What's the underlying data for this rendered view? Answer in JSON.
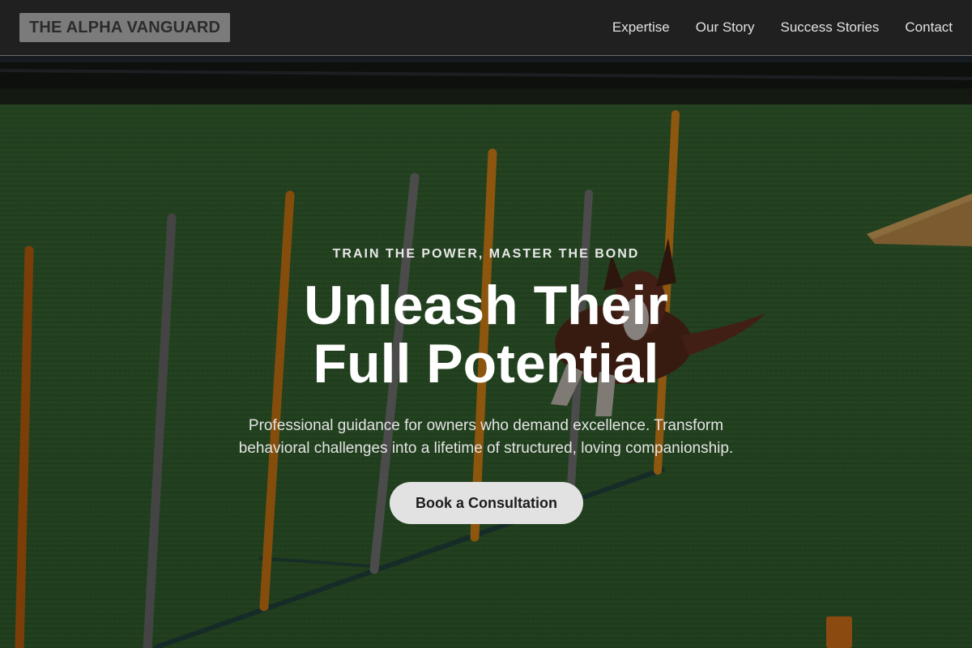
{
  "header": {
    "logo": "THE ALPHA VANGUARD",
    "nav": [
      {
        "label": "Expertise"
      },
      {
        "label": "Our Story"
      },
      {
        "label": "Success Stories"
      },
      {
        "label": "Contact"
      }
    ]
  },
  "hero": {
    "eyebrow": "TRAIN THE POWER, MASTER THE BOND",
    "title_line1": "Unleash Their",
    "title_line2": "Full Potential",
    "subtitle": "Professional guidance for owners who demand excellence. Transform behavioral challenges into a lifetime of structured, loving companionship.",
    "cta_label": "Book a Consultation",
    "background_image": "dog-agility-weave-poles-photo"
  },
  "colors": {
    "header_bg": "#202020",
    "logo_bg": "#7b7b7b",
    "cta_bg": "#e2e2e2",
    "grass": "#2f5a2e"
  }
}
